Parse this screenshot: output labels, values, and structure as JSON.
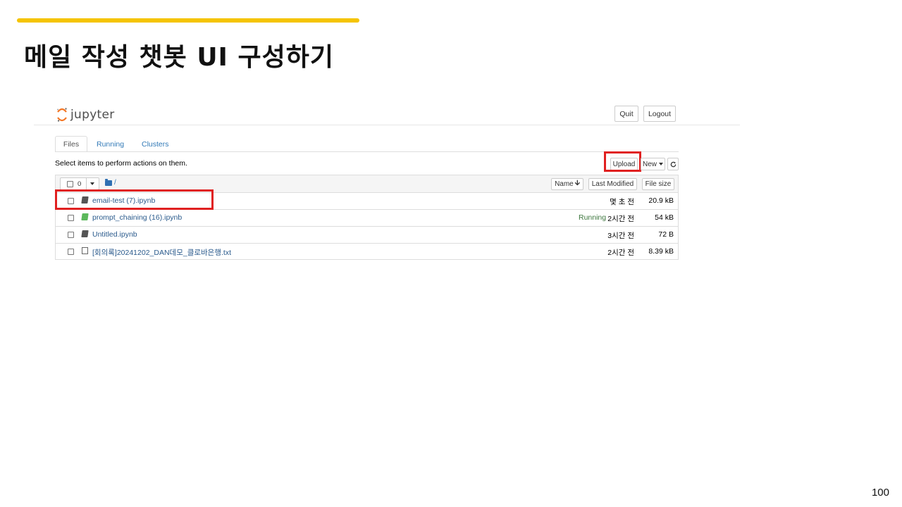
{
  "slide": {
    "title": "메일 작성 챗봇 UI 구성하기",
    "page_number": "100",
    "accent_color": "#f5c400",
    "highlight_color": "#e02020"
  },
  "jupyter": {
    "logo_text": "jupyter",
    "header_buttons": {
      "quit": "Quit",
      "logout": "Logout"
    },
    "tabs": [
      {
        "label": "Files",
        "active": true
      },
      {
        "label": "Running",
        "active": false
      },
      {
        "label": "Clusters",
        "active": false
      }
    ],
    "toolbar": {
      "select_text": "Select items to perform actions on them.",
      "upload": "Upload",
      "new": "New",
      "refresh_icon": "refresh-icon"
    },
    "list_header": {
      "selected_count": "0",
      "breadcrumb": "/",
      "sort_name": "Name",
      "sort_name_arrow": "🡫",
      "sort_modified": "Last Modified",
      "sort_size": "File size"
    },
    "files": [
      {
        "name": "email-test (7).ipynb",
        "type": "notebook",
        "running": false,
        "status": "",
        "modified": "몇 초 전",
        "size": "20.9 kB"
      },
      {
        "name": "prompt_chaining (16).ipynb",
        "type": "notebook",
        "running": true,
        "status": "Running",
        "modified": "2시간 전",
        "size": "54 kB"
      },
      {
        "name": "Untitled.ipynb",
        "type": "notebook",
        "running": false,
        "status": "",
        "modified": "3시간 전",
        "size": "72 B"
      },
      {
        "name": "[회의록]20241202_DAN데모_클로바은행.txt",
        "type": "text",
        "running": false,
        "status": "",
        "modified": "2시간 전",
        "size": "8.39 kB"
      }
    ]
  }
}
